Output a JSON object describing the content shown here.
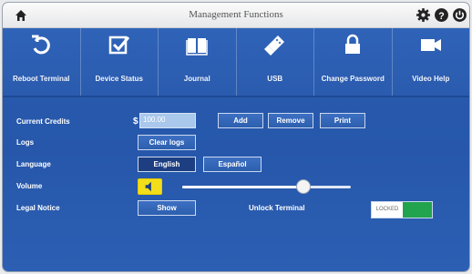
{
  "titlebar": {
    "title": "Management Functions",
    "icons": [
      "home-icon",
      "settings-icon",
      "help-icon",
      "power-icon"
    ]
  },
  "toolbar": {
    "items": [
      {
        "label": "Reboot Terminal",
        "icon": "reboot-icon"
      },
      {
        "label": "Device Status",
        "icon": "checkbox-icon"
      },
      {
        "label": "Journal",
        "icon": "book-icon"
      },
      {
        "label": "USB",
        "icon": "usb-icon"
      },
      {
        "label": "Change Password",
        "icon": "lock-icon"
      },
      {
        "label": "Video Help",
        "icon": "video-icon"
      }
    ]
  },
  "settings": {
    "current_credits": {
      "label": "Current Credits",
      "currency": "$",
      "value": "100.00",
      "buttons": {
        "add": "Add",
        "remove": "Remove",
        "print": "Print"
      }
    },
    "logs": {
      "label": "Logs",
      "button": "Clear logs"
    },
    "language": {
      "label": "Language",
      "options": [
        "English",
        "Español"
      ],
      "selected": "English"
    },
    "volume": {
      "label": "Volume",
      "icon": "speaker-icon",
      "level": 0.72
    },
    "legal_notice": {
      "label": "Legal Notice",
      "button": "Show"
    },
    "unlock_terminal": {
      "label": "Unlock Terminal",
      "state": "on",
      "off_label": "LOCKED"
    }
  },
  "colors": {
    "accent": "#2a5bae",
    "toggle_on": "#22a34d",
    "volume_button": "#f2de1b"
  }
}
